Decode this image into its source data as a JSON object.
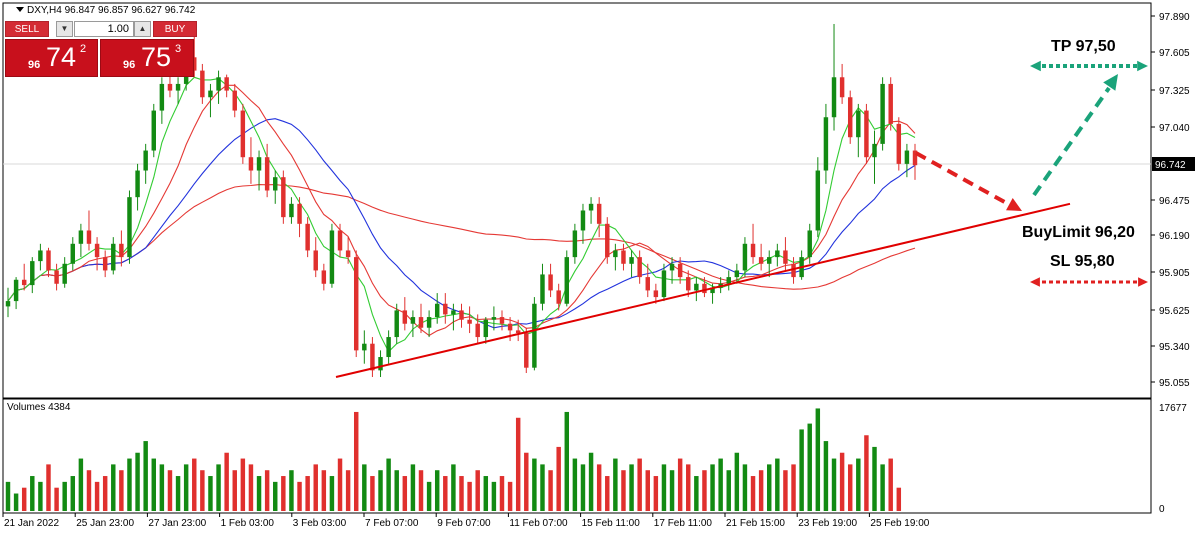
{
  "symbol_header": {
    "text": "DXY,H4  96.847 96.857 96.627 96.742"
  },
  "trade_panel": {
    "sell_label": "SELL",
    "buy_label": "BUY",
    "lot_value": "1.00",
    "sell_price": {
      "prefix": "96",
      "big": "74",
      "sup": "2"
    },
    "buy_price": {
      "prefix": "96",
      "big": "75",
      "sup": "3"
    }
  },
  "price_axis": {
    "ticks": [
      "97.890",
      "97.605",
      "97.325",
      "97.040",
      "96.742",
      "96.475",
      "96.190",
      "95.905",
      "95.625",
      "95.340",
      "95.055"
    ],
    "current_price_label": "96.742"
  },
  "volume_panel": {
    "title": "Volumes 4384",
    "ticks": [
      "17677",
      "0"
    ]
  },
  "time_axis": {
    "labels": [
      "21 Jan 2022",
      "25 Jan 23:00",
      "27 Jan 23:00",
      "1 Feb 03:00",
      "3 Feb 03:00",
      "7 Feb 07:00",
      "9 Feb 07:00",
      "11 Feb 07:00",
      "15 Feb 11:00",
      "17 Feb 11:00",
      "21 Feb 15:00",
      "23 Feb 19:00",
      "25 Feb 19:00"
    ]
  },
  "annotations": {
    "take_profit": "TP 97,50",
    "buy_limit": "BuyLimit 96,20",
    "stop_loss": "SL 95,80"
  },
  "colors": {
    "bull": "#138a13",
    "bear": "#e0302e",
    "ma_fast": "#33cc33",
    "ma_mid": "#e53935",
    "ma_slow": "#2233dd",
    "ma_long": "#e53935",
    "trendline": "#e00000",
    "arrow_red": "#e02020",
    "arrow_green": "#1aa37a"
  },
  "chart_data": {
    "type": "candlestick",
    "symbol": "DXY",
    "timeframe": "H4",
    "ylim": [
      95.0,
      97.95
    ],
    "ohlc": [
      [
        95.68,
        95.82,
        95.6,
        95.72
      ],
      [
        95.72,
        95.9,
        95.66,
        95.88
      ],
      [
        95.88,
        96.0,
        95.8,
        95.84
      ],
      [
        95.84,
        96.05,
        95.78,
        96.02
      ],
      [
        96.02,
        96.15,
        95.95,
        96.1
      ],
      [
        96.1,
        96.12,
        95.9,
        95.95
      ],
      [
        95.95,
        96.0,
        95.8,
        95.85
      ],
      [
        95.85,
        96.05,
        95.82,
        96.0
      ],
      [
        96.0,
        96.2,
        95.95,
        96.15
      ],
      [
        96.15,
        96.3,
        96.05,
        96.25
      ],
      [
        96.25,
        96.4,
        96.1,
        96.15
      ],
      [
        96.15,
        96.2,
        95.95,
        96.05
      ],
      [
        96.05,
        96.1,
        95.9,
        95.95
      ],
      [
        95.95,
        96.2,
        95.92,
        96.15
      ],
      [
        96.15,
        96.25,
        95.98,
        96.05
      ],
      [
        96.05,
        96.55,
        96.0,
        96.5
      ],
      [
        96.5,
        96.75,
        96.4,
        96.7
      ],
      [
        96.7,
        96.9,
        96.6,
        96.85
      ],
      [
        96.85,
        97.2,
        96.8,
        97.15
      ],
      [
        97.15,
        97.4,
        97.05,
        97.35
      ],
      [
        97.35,
        97.45,
        97.25,
        97.3
      ],
      [
        97.3,
        97.4,
        97.2,
        97.35
      ],
      [
        97.35,
        97.6,
        97.3,
        97.55
      ],
      [
        97.55,
        97.75,
        97.4,
        97.45
      ],
      [
        97.45,
        97.5,
        97.2,
        97.25
      ],
      [
        97.25,
        97.35,
        97.1,
        97.3
      ],
      [
        97.3,
        97.45,
        97.2,
        97.4
      ],
      [
        97.4,
        97.42,
        97.25,
        97.3
      ],
      [
        97.3,
        97.35,
        97.1,
        97.15
      ],
      [
        97.15,
        97.2,
        96.75,
        96.8
      ],
      [
        96.8,
        96.95,
        96.6,
        96.7
      ],
      [
        96.7,
        96.85,
        96.55,
        96.8
      ],
      [
        96.8,
        96.9,
        96.5,
        96.55
      ],
      [
        96.55,
        96.7,
        96.45,
        96.65
      ],
      [
        96.65,
        96.7,
        96.3,
        96.35
      ],
      [
        96.35,
        96.5,
        96.3,
        96.45
      ],
      [
        96.45,
        96.5,
        96.2,
        96.3
      ],
      [
        96.3,
        96.35,
        96.05,
        96.1
      ],
      [
        96.1,
        96.2,
        95.9,
        95.95
      ],
      [
        95.95,
        96.0,
        95.8,
        95.85
      ],
      [
        95.85,
        96.3,
        95.82,
        96.25
      ],
      [
        96.25,
        96.3,
        96.05,
        96.1
      ],
      [
        96.1,
        96.2,
        96.0,
        96.05
      ],
      [
        96.05,
        96.1,
        95.3,
        95.35
      ],
      [
        95.35,
        95.5,
        95.25,
        95.4
      ],
      [
        95.4,
        95.45,
        95.15,
        95.2
      ],
      [
        95.2,
        95.35,
        95.15,
        95.3
      ],
      [
        95.3,
        95.5,
        95.25,
        95.45
      ],
      [
        95.45,
        95.7,
        95.4,
        95.65
      ],
      [
        95.65,
        95.75,
        95.5,
        95.55
      ],
      [
        95.55,
        95.65,
        95.45,
        95.6
      ],
      [
        95.6,
        95.7,
        95.48,
        95.52
      ],
      [
        95.52,
        95.65,
        95.45,
        95.6
      ],
      [
        95.6,
        95.78,
        95.55,
        95.7
      ],
      [
        95.7,
        95.78,
        95.55,
        95.62
      ],
      [
        95.62,
        95.7,
        95.5,
        95.65
      ],
      [
        95.65,
        95.7,
        95.52,
        95.58
      ],
      [
        95.58,
        95.68,
        95.48,
        95.55
      ],
      [
        95.55,
        95.62,
        95.4,
        95.45
      ],
      [
        95.45,
        95.6,
        95.4,
        95.58
      ],
      [
        95.58,
        95.68,
        95.5,
        95.6
      ],
      [
        95.6,
        95.65,
        95.5,
        95.55
      ],
      [
        95.55,
        95.6,
        95.42,
        95.5
      ],
      [
        95.5,
        95.58,
        95.42,
        95.48
      ],
      [
        95.48,
        95.52,
        95.18,
        95.22
      ],
      [
        95.22,
        95.75,
        95.2,
        95.7
      ],
      [
        95.7,
        96.0,
        95.65,
        95.92
      ],
      [
        95.92,
        96.0,
        95.75,
        95.8
      ],
      [
        95.8,
        95.85,
        95.65,
        95.7
      ],
      [
        95.7,
        96.1,
        95.68,
        96.05
      ],
      [
        96.05,
        96.3,
        96.0,
        96.25
      ],
      [
        96.25,
        96.45,
        96.15,
        96.4
      ],
      [
        96.4,
        96.5,
        96.3,
        96.45
      ],
      [
        96.45,
        96.5,
        96.2,
        96.3
      ],
      [
        96.3,
        96.35,
        96.0,
        96.05
      ],
      [
        96.05,
        96.15,
        95.95,
        96.1
      ],
      [
        96.1,
        96.15,
        95.95,
        96.0
      ],
      [
        96.0,
        96.1,
        95.9,
        96.05
      ],
      [
        96.05,
        96.1,
        95.85,
        95.9
      ],
      [
        95.9,
        96.0,
        95.75,
        95.8
      ],
      [
        95.8,
        95.85,
        95.7,
        95.75
      ],
      [
        95.75,
        96.0,
        95.72,
        95.95
      ],
      [
        95.95,
        96.05,
        95.85,
        96.0
      ],
      [
        96.0,
        96.05,
        95.85,
        95.9
      ],
      [
        95.9,
        95.95,
        95.75,
        95.8
      ],
      [
        95.8,
        95.9,
        95.72,
        95.85
      ],
      [
        95.85,
        95.9,
        95.75,
        95.78
      ],
      [
        95.78,
        95.85,
        95.7,
        95.82
      ],
      [
        95.82,
        95.9,
        95.78,
        95.85
      ],
      [
        95.85,
        95.95,
        95.8,
        95.9
      ],
      [
        95.9,
        96.0,
        95.85,
        95.95
      ],
      [
        95.95,
        96.2,
        95.9,
        96.15
      ],
      [
        96.15,
        96.3,
        96.0,
        96.05
      ],
      [
        96.05,
        96.15,
        95.95,
        96.0
      ],
      [
        96.0,
        96.1,
        95.9,
        96.05
      ],
      [
        96.05,
        96.15,
        95.98,
        96.1
      ],
      [
        96.1,
        96.2,
        95.95,
        96.0
      ],
      [
        96.0,
        96.05,
        95.85,
        95.9
      ],
      [
        95.9,
        96.1,
        95.88,
        96.05
      ],
      [
        96.05,
        96.3,
        96.0,
        96.25
      ],
      [
        96.25,
        96.8,
        96.2,
        96.7
      ],
      [
        96.7,
        97.2,
        96.6,
        97.1
      ],
      [
        97.1,
        97.8,
        97.0,
        97.4
      ],
      [
        97.4,
        97.5,
        97.2,
        97.25
      ],
      [
        97.25,
        97.3,
        96.9,
        96.95
      ],
      [
        96.95,
        97.2,
        96.8,
        97.15
      ],
      [
        97.15,
        97.2,
        96.75,
        96.8
      ],
      [
        96.8,
        97.0,
        96.6,
        96.9
      ],
      [
        96.9,
        97.4,
        96.85,
        97.35
      ],
      [
        97.35,
        97.4,
        97.0,
        97.05
      ],
      [
        97.05,
        97.1,
        96.7,
        96.75
      ],
      [
        96.75,
        96.9,
        96.65,
        96.85
      ],
      [
        96.85,
        96.9,
        96.63,
        96.74
      ]
    ],
    "volume": [
      5,
      3,
      4,
      6,
      5,
      8,
      4,
      5,
      6,
      9,
      7,
      5,
      6,
      8,
      7,
      9,
      10,
      12,
      9,
      8,
      7,
      6,
      8,
      9,
      7,
      6,
      8,
      10,
      7,
      9,
      8,
      6,
      7,
      5,
      6,
      7,
      5,
      6,
      8,
      7,
      6,
      9,
      7,
      17,
      8,
      6,
      7,
      9,
      7,
      6,
      8,
      7,
      5,
      7,
      6,
      8,
      6,
      5,
      7,
      6,
      5,
      6,
      5,
      16,
      10,
      9,
      8,
      7,
      11,
      17,
      9,
      8,
      10,
      8,
      6,
      9,
      7,
      8,
      9,
      7,
      6,
      8,
      7,
      9,
      8,
      6,
      7,
      8,
      9,
      7,
      10,
      8,
      6,
      7,
      8,
      9,
      7,
      8,
      14,
      15,
      17.6,
      12,
      9,
      10,
      8,
      9,
      13,
      11,
      8,
      9,
      4
    ],
    "volume_ylim": [
      0,
      17677
    ],
    "moving_averages": [
      "green",
      "red",
      "blue",
      "red-long"
    ],
    "trendline": {
      "from_price": 95.15,
      "to_price": 96.45
    },
    "levels": {
      "take_profit": 97.5,
      "buy_limit": 96.2,
      "stop_loss": 95.8
    }
  }
}
